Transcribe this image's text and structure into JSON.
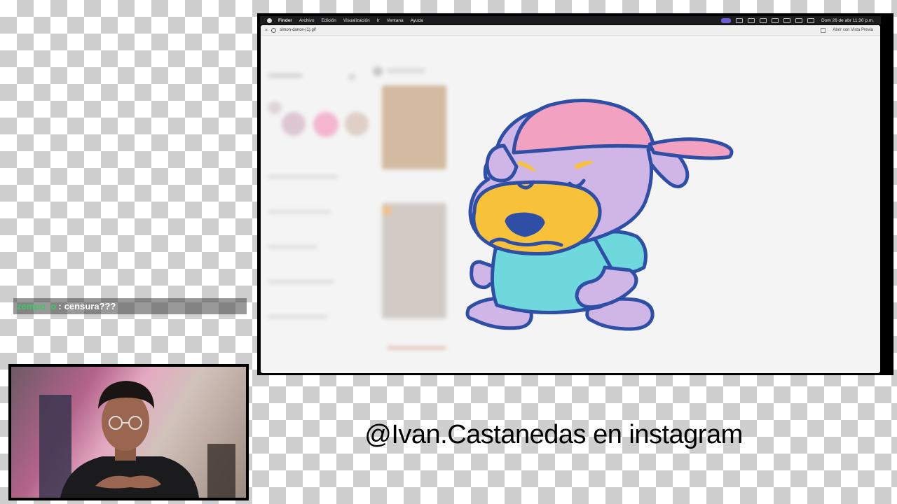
{
  "menubar": {
    "items": [
      "Finder",
      "Archivo",
      "Edición",
      "Visualización",
      "Ir",
      "Ventana",
      "Ayuda"
    ],
    "clock": "Dom 26 de abr  11:30 p.m."
  },
  "preview": {
    "filename": "simon-dance-(1).gif",
    "open_button": "Abrir con Vista Previa"
  },
  "chat": {
    "username": "zempo_o",
    "separator": ":",
    "message": "censura???"
  },
  "caption": "@Ivan.Castanedas en instagram",
  "colors": {
    "chat_username": "#3ec76a",
    "dog_outline": "#2f4fa6",
    "dog_body": "#cfb6e6",
    "dog_cap": "#f2a1c1",
    "dog_muzzle": "#f7c23a",
    "dog_shirt": "#6fd8dc"
  }
}
